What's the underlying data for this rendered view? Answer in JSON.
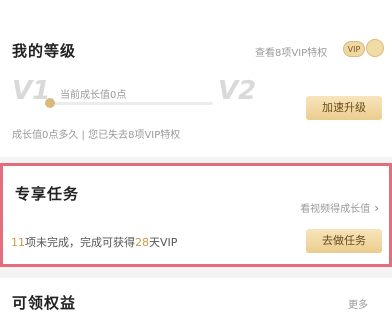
{
  "level": {
    "title": "我的等级",
    "privileges_link": "查看8项VIP特权",
    "badge": "VIP",
    "current_level": "V1",
    "next_level": "V2",
    "growth_current": "当前成长值0点",
    "progress_fraction": 0.0,
    "speed_button": "加速升级",
    "growth_note": "成长值0点多久 | 您已失去8项VIP特权"
  },
  "tasks": {
    "title": "专享任务",
    "link": "看视频得成长值",
    "desc_count": "11",
    "desc_text1": "项未完成，完成可获得",
    "desc_days": "28",
    "desc_text2": "天VIP",
    "button": "去做任务"
  },
  "benefits": {
    "title": "可领权益",
    "more": "更多"
  }
}
